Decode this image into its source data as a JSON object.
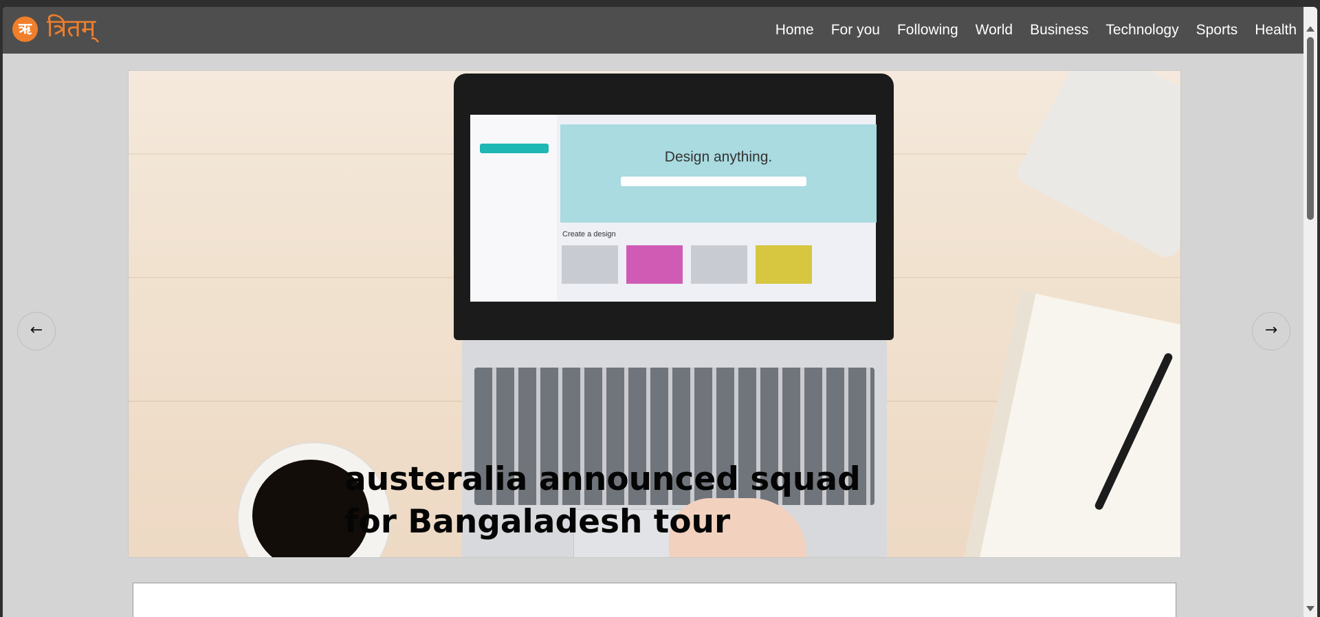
{
  "brand": {
    "logo_glyph": "ऋ",
    "name": "त्रितम्",
    "accent_color": "#f07f2b"
  },
  "nav": {
    "items": [
      "Home",
      "For you",
      "Following",
      "World",
      "Business",
      "Technology",
      "Sports",
      "Health"
    ]
  },
  "hero": {
    "title": "austeralia announced squad for Bangaladesh tour",
    "image_screen_text": "Design anything.",
    "image_section_text": "Create a design"
  },
  "carousel": {
    "prev_icon": "arrow-left-icon",
    "next_icon": "arrow-right-icon",
    "prev_glyph": "←",
    "next_glyph": "→"
  }
}
